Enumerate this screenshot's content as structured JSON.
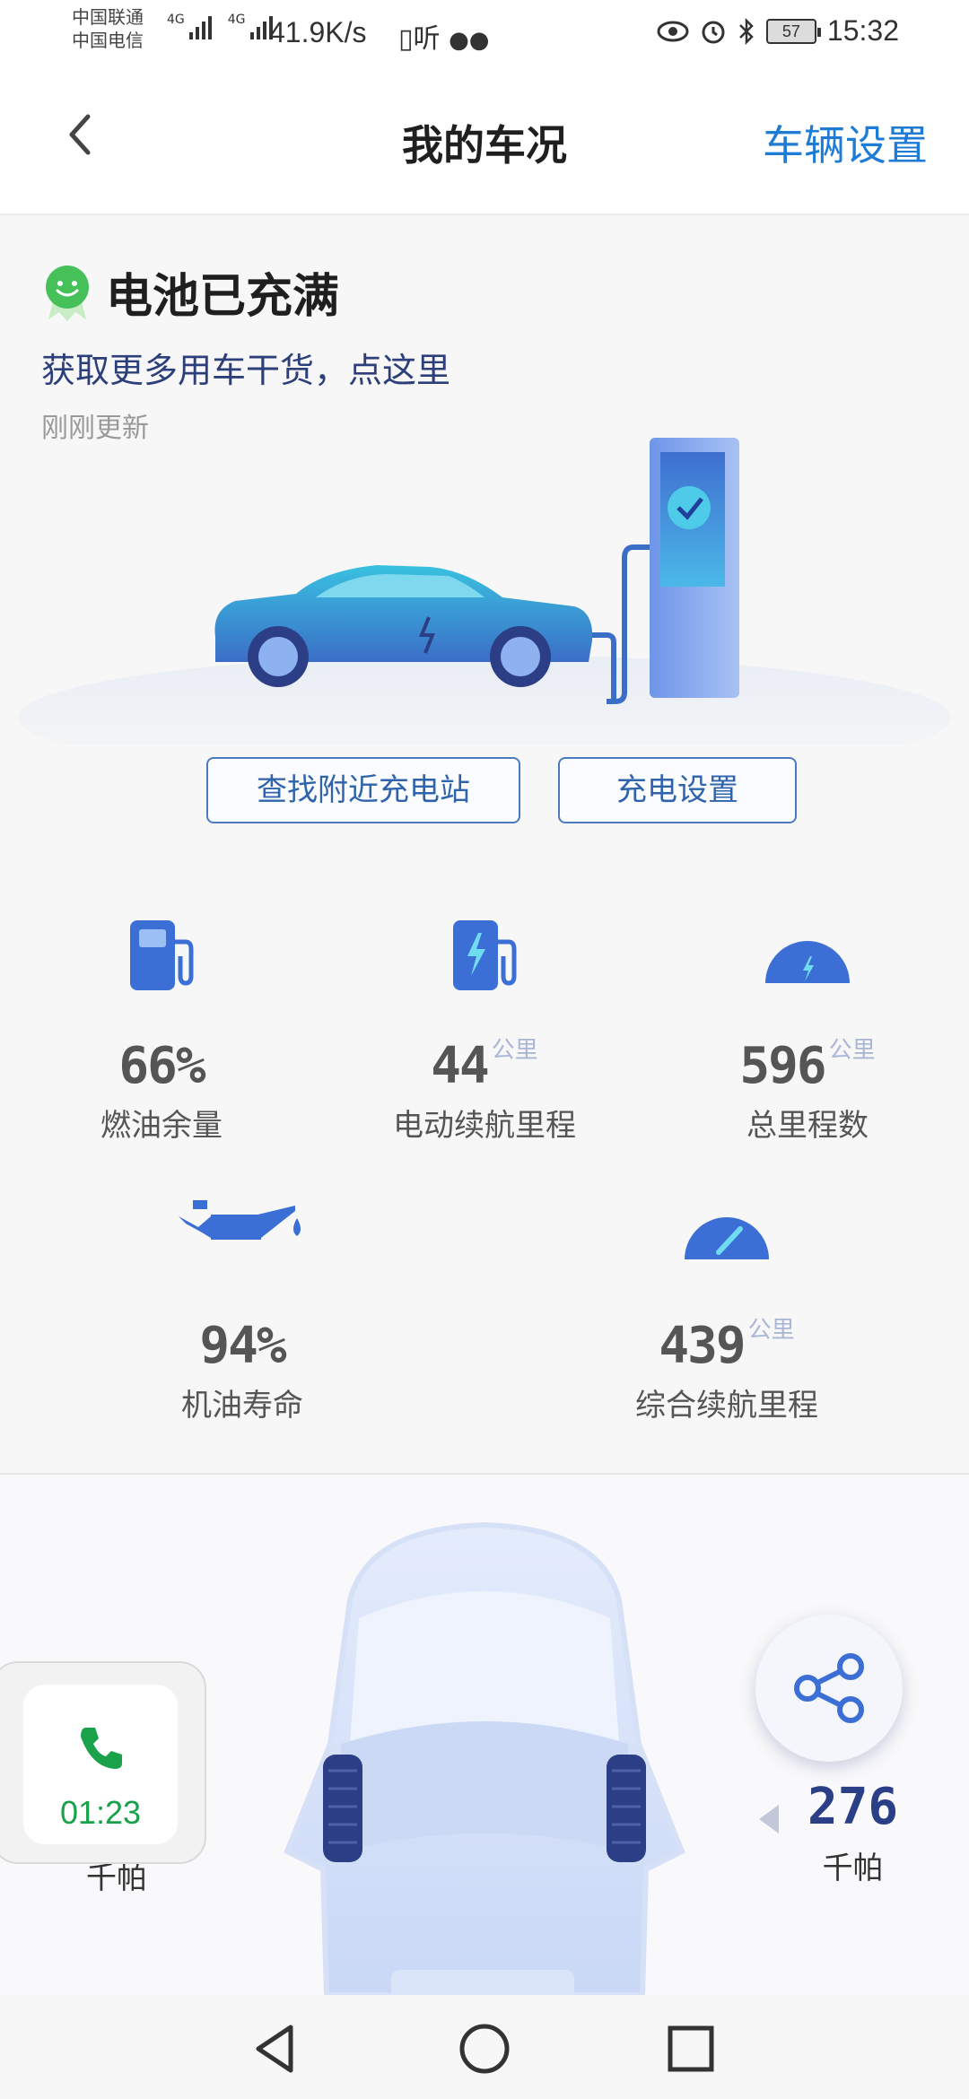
{
  "status_bar": {
    "carrier1": "中国联通",
    "carrier2": "中国电信",
    "net1": "4G",
    "net2": "4G",
    "speed": "41.9K/s",
    "battery": "57",
    "time": "15:32",
    "icons": [
      "hd-icon",
      "wechat-icon",
      "eye-icon",
      "alarm-icon",
      "bluetooth-icon",
      "battery-icon"
    ]
  },
  "header": {
    "title": "我的车况",
    "settings_label": "车辆设置"
  },
  "status": {
    "title": "电池已充满",
    "link": "获取更多用车干货，点这里",
    "updated": "刚刚更新"
  },
  "actions": {
    "find_station": "查找附近充电站",
    "charge_settings": "充电设置"
  },
  "stats": {
    "fuel": {
      "value": "66%",
      "label": "燃油余量"
    },
    "electric_range": {
      "value": "44",
      "unit": "公里",
      "label": "电动续航里程"
    },
    "odometer": {
      "value": "596",
      "unit": "公里",
      "label": "总里程数"
    },
    "oil_life": {
      "value": "94%",
      "label": "机油寿命"
    },
    "total_range": {
      "value": "439",
      "unit": "公里",
      "label": "综合续航里程"
    }
  },
  "tires": {
    "right_pressure": "276",
    "unit_right": "千帕",
    "unit_left": "千帕"
  },
  "call": {
    "timer": "01:23"
  },
  "colors": {
    "accent": "#1e7bd6",
    "dark_blue": "#2a3f86",
    "call_green": "#19a24a"
  }
}
